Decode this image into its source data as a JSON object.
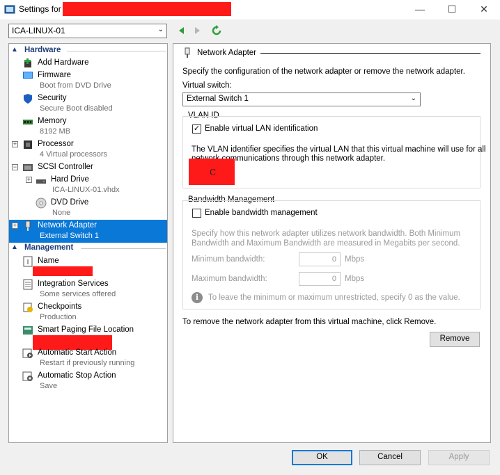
{
  "window": {
    "title": "Settings for",
    "minimize": "—",
    "maximize": "☐",
    "close": "✕"
  },
  "vm_selector": {
    "value": "ICA-LINUX-01"
  },
  "sidebar": {
    "hardware_header": "Hardware",
    "management_header": "Management",
    "hardware_items": [
      {
        "name": "Add Hardware",
        "sub": ""
      },
      {
        "name": "Firmware",
        "sub": "Boot from DVD Drive"
      },
      {
        "name": "Security",
        "sub": "Secure Boot disabled"
      },
      {
        "name": "Memory",
        "sub": "8192 MB"
      },
      {
        "name": "Processor",
        "sub": "4 Virtual processors"
      },
      {
        "name": "SCSI Controller",
        "sub": ""
      },
      {
        "name": "Hard Drive",
        "sub": "ICA-LINUX-01.vhdx"
      },
      {
        "name": "DVD Drive",
        "sub": "None"
      },
      {
        "name": "Network Adapter",
        "sub": "External Switch 1"
      }
    ],
    "management_items": [
      {
        "name": "Name",
        "sub": ""
      },
      {
        "name": "Integration Services",
        "sub": "Some services offered"
      },
      {
        "name": "Checkpoints",
        "sub": "Production"
      },
      {
        "name": "Smart Paging File Location",
        "sub": ""
      },
      {
        "name": "Automatic Start Action",
        "sub": "Restart if previously running"
      },
      {
        "name": "Automatic Stop Action",
        "sub": "Save"
      }
    ]
  },
  "panel": {
    "title": "Network Adapter",
    "description": "Specify the configuration of the network adapter or remove the network adapter.",
    "switch_label": "Virtual switch:",
    "switch_value": "External Switch 1",
    "vlan": {
      "header": "VLAN ID",
      "checkbox_label": "Enable virtual LAN identification",
      "checked": true,
      "desc_line1": "The VLAN identifier specifies the virtual LAN that this virtual machine will use for all",
      "desc_line2": "network communications through this network adapter.",
      "redaction_mark": "C"
    },
    "bandwidth": {
      "header": "Bandwidth Management",
      "checkbox_label": "Enable bandwidth management",
      "checked": false,
      "desc_line1": "Specify how this network adapter utilizes network bandwidth. Both Minimum",
      "desc_line2": "Bandwidth and Maximum Bandwidth are measured in Megabits per second.",
      "min_label": "Minimum bandwidth:",
      "min_value": "0",
      "max_label": "Maximum bandwidth:",
      "max_value": "0",
      "unit": "Mbps",
      "info": "To leave the minimum or maximum unrestricted, specify 0 as the value."
    },
    "remove_text": "To remove the network adapter from this virtual machine, click Remove.",
    "remove_button": "Remove"
  },
  "footer": {
    "ok": "OK",
    "cancel": "Cancel",
    "apply": "Apply"
  },
  "colors": {
    "selection": "#0a78d7",
    "section_header": "#1e3d7b",
    "redaction": "#ff1a1a"
  }
}
